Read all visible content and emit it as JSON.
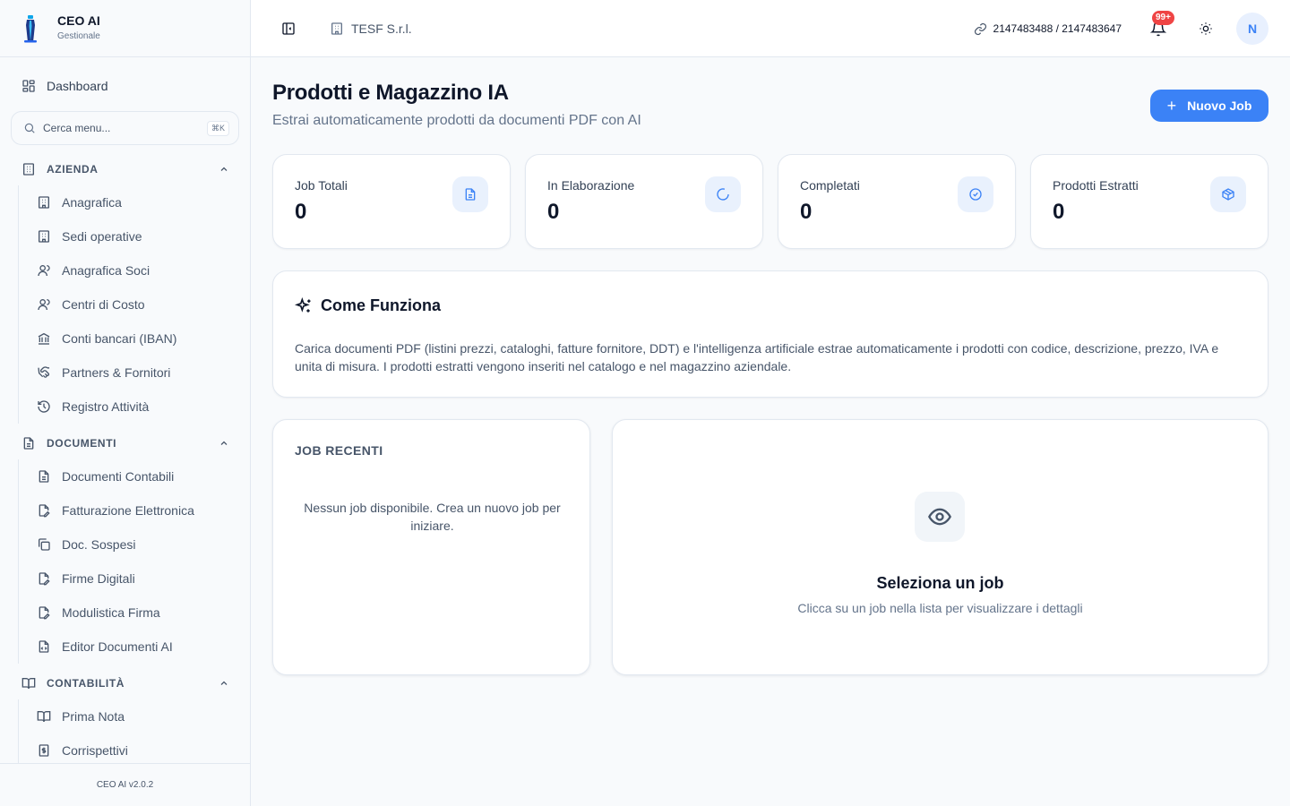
{
  "brand": {
    "name": "CEO AI",
    "subtitle": "Gestionale",
    "version": "CEO AI v2.0.2"
  },
  "sidebar": {
    "dashboard": "Dashboard",
    "search": {
      "placeholder": "Cerca menu...",
      "shortcut": "⌘K"
    },
    "sections": [
      {
        "title": "AZIENDA",
        "items": [
          "Anagrafica",
          "Sedi operative",
          "Anagrafica Soci",
          "Centri di Costo",
          "Conti bancari (IBAN)",
          "Partners & Fornitori",
          "Registro Attività"
        ]
      },
      {
        "title": "DOCUMENTI",
        "items": [
          "Documenti Contabili",
          "Fatturazione Elettronica",
          "Doc. Sospesi",
          "Firme Digitali",
          "Modulistica Firma",
          "Editor Documenti AI"
        ]
      },
      {
        "title": "CONTABILITÀ",
        "items": [
          "Prima Nota",
          "Corrispettivi"
        ]
      }
    ]
  },
  "header": {
    "company": "TESF S.r.l.",
    "ids": "2147483488 / 2147483647",
    "notifications_badge": "99+",
    "avatar_initial": "N"
  },
  "page": {
    "title": "Prodotti e Magazzino IA",
    "subtitle": "Estrai automaticamente prodotti da documenti PDF con AI",
    "new_job_label": "Nuovo Job"
  },
  "stats": [
    {
      "label": "Job Totali",
      "value": "0"
    },
    {
      "label": "In Elaborazione",
      "value": "0"
    },
    {
      "label": "Completati",
      "value": "0"
    },
    {
      "label": "Prodotti Estratti",
      "value": "0"
    }
  ],
  "how_it_works": {
    "title": "Come Funziona",
    "description": "Carica documenti PDF (listini prezzi, cataloghi, fatture fornitore, DDT) e l'intelligenza artificiale estrae automaticamente i prodotti con codice, descrizione, prezzo, IVA e unita di misura. I prodotti estratti vengono inseriti nel catalogo e nel magazzino aziendale."
  },
  "recent_jobs": {
    "title": "JOB RECENTI",
    "empty": "Nessun job disponibile. Crea un nuovo job per iniziare."
  },
  "detail": {
    "title": "Seleziona un job",
    "subtitle": "Clicca su un job nella lista per visualizzare i dettagli"
  },
  "colors": {
    "accent": "#3b82f6",
    "badge": "#ef4444",
    "text": "#0f172a",
    "muted": "#64748b"
  }
}
